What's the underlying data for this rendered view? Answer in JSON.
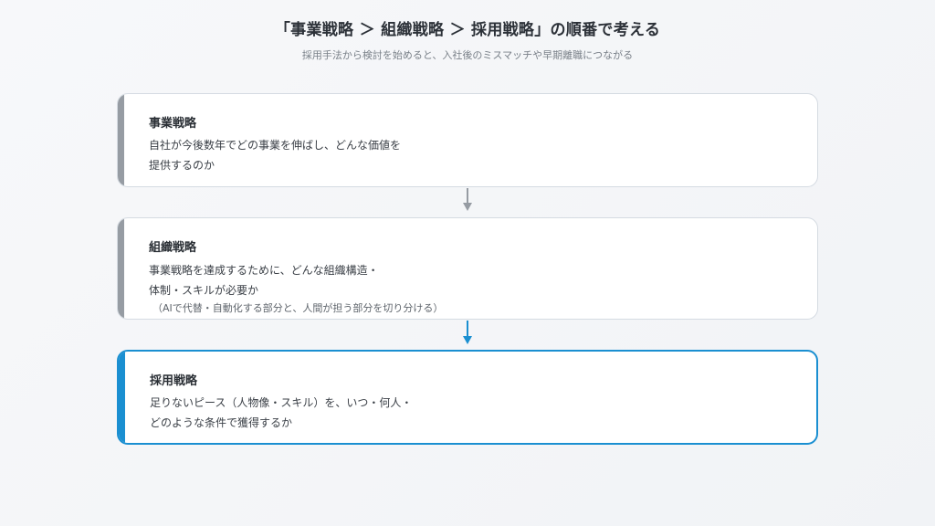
{
  "header": {
    "title": "「事業戦略 ＞ 組織戦略 ＞ 採用戦略」の順番で考える",
    "subtitle": "採用手法から検討を始めると、入社後のミスマッチや早期離職につながる"
  },
  "steps": [
    {
      "title": "事業戦略",
      "lines": [
        "自社が今後数年でどの事業を伸ばし、どんな価値を",
        "提供するのか"
      ],
      "note": ""
    },
    {
      "title": "組織戦略",
      "lines": [
        "事業戦略を達成するために、どんな組織構造・",
        "体制・スキルが必要か"
      ],
      "note": "（AIで代替・自動化する部分と、人間が担う部分を切り分ける）"
    },
    {
      "title": "採用戦略",
      "lines": [
        "足りないピース（人物像・スキル）を、いつ・何人・",
        "どのような条件で獲得するか"
      ],
      "note": ""
    }
  ],
  "colors": {
    "accent_gray": "#969ca3",
    "accent_blue": "#1a8fd1",
    "arrow_gray": "#969ca3",
    "arrow_blue": "#1a8fd1"
  },
  "icons": {
    "connector_1": "arrow-down-icon",
    "connector_2": "arrow-down-icon"
  }
}
